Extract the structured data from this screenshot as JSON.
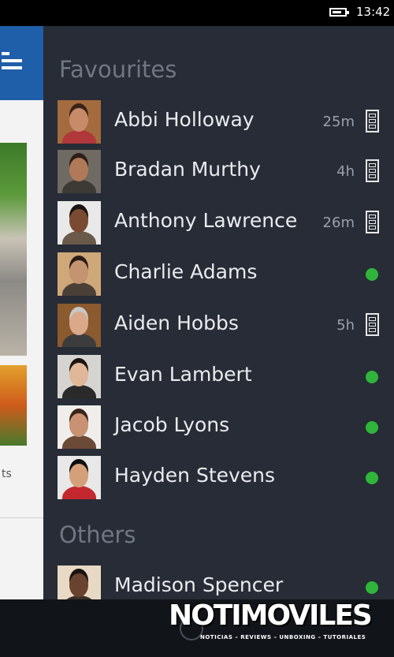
{
  "status_bar": {
    "time": "13:42",
    "battery_level": 0.8
  },
  "background_app": {
    "caption_partial": "ts"
  },
  "panel": {
    "favourites_title": "Favourites",
    "favourites": [
      {
        "name": "Abbi Holloway",
        "status": "mobile",
        "time": "25m",
        "skin": "#c78b6a",
        "hair": "#3a2418",
        "shirt": "#b0373a",
        "bg": "#a46b3e"
      },
      {
        "name": "Bradan Murthy",
        "status": "mobile",
        "time": "4h",
        "skin": "#b07a59",
        "hair": "#2d1f17",
        "shirt": "#3d3a36",
        "bg": "#6f6a62"
      },
      {
        "name": "Anthony Lawrence",
        "status": "mobile",
        "time": "26m",
        "skin": "#7a4a32",
        "hair": "#1a1412",
        "shirt": "#6b5a4a",
        "bg": "#e9e9e9"
      },
      {
        "name": "Charlie Adams",
        "status": "online",
        "time": "",
        "skin": "#c49370",
        "hair": "#2a1c13",
        "shirt": "#4a4037",
        "bg": "#cfa87a"
      },
      {
        "name": "Aiden Hobbs",
        "status": "mobile",
        "time": "5h",
        "skin": "#d9a98a",
        "hair": "#c8c8c8",
        "shirt": "#3c3c3c",
        "bg": "#8b5a2e"
      },
      {
        "name": "Evan Lambert",
        "status": "online",
        "time": "",
        "skin": "#e1b799",
        "hair": "#1c1410",
        "shirt": "#2a2a2a",
        "bg": "#d6d4d0"
      },
      {
        "name": "Jacob Lyons",
        "status": "online",
        "time": "",
        "skin": "#c99272",
        "hair": "#3a2418",
        "shirt": "#6b4a37",
        "bg": "#f0eeeb"
      },
      {
        "name": "Hayden Stevens",
        "status": "online",
        "time": "",
        "skin": "#d4a07a",
        "hair": "#0f0d0c",
        "shirt": "#c4282f",
        "bg": "#e8e8e8"
      }
    ],
    "others_title": "Others",
    "others": [
      {
        "name": "Madison Spencer",
        "status": "online",
        "time": "",
        "skin": "#6a4330",
        "hair": "#1a1210",
        "shirt": "#3a2f28",
        "bg": "#e8d9c4"
      }
    ]
  },
  "watermark": {
    "logo": "NOTIMOVILES",
    "tagline": "NOTICIAS – REVIEWS – UNBOXING – TUTORIALES"
  },
  "colors": {
    "panel_bg": "#272c36",
    "online": "#2fb53a",
    "section_title": "#707782",
    "header_blue": "#1f5ea8"
  }
}
